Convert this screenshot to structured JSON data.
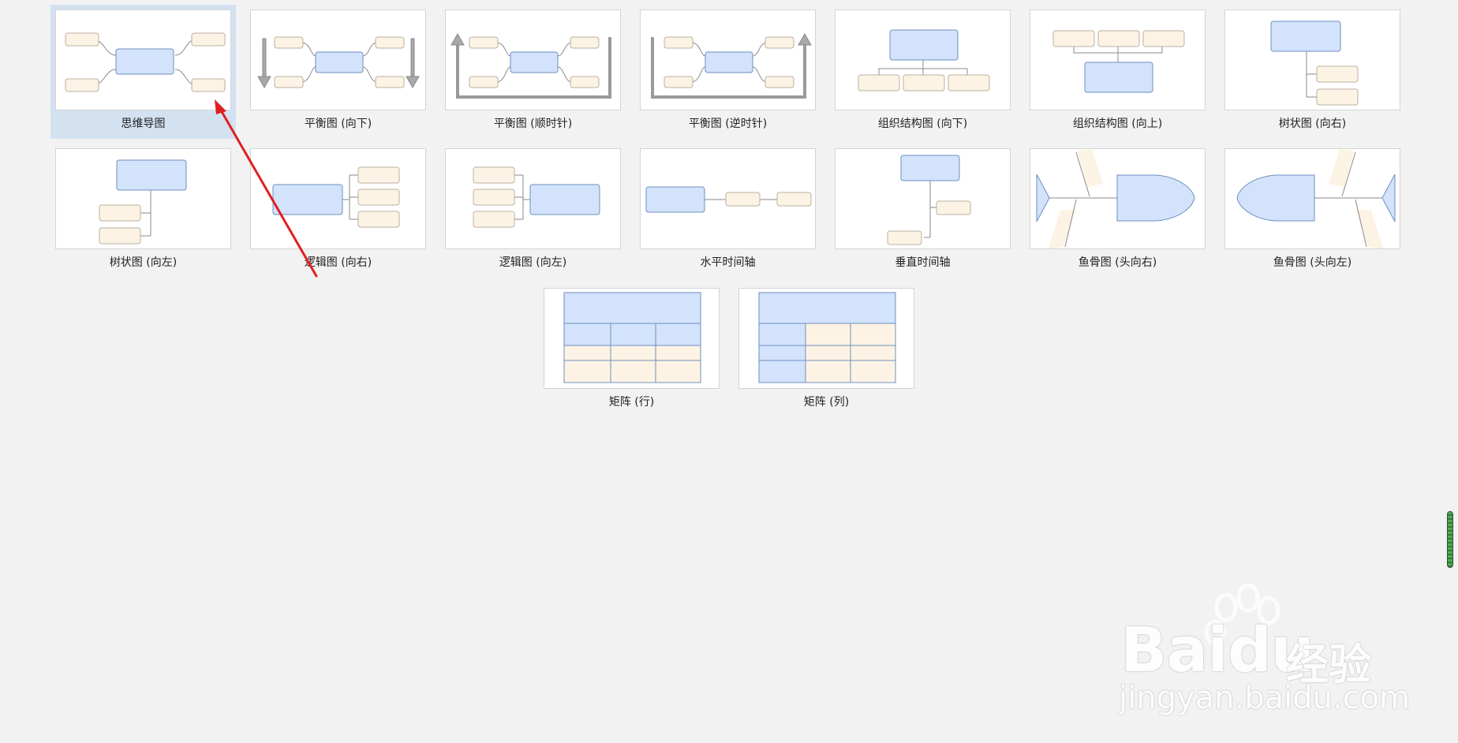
{
  "templates": [
    {
      "id": "mind-map",
      "label": "思维导图",
      "selected": true
    },
    {
      "id": "balance-down",
      "label": "平衡图 (向下)"
    },
    {
      "id": "balance-clockwise",
      "label": "平衡图 (顺时针)"
    },
    {
      "id": "balance-counterclockwise",
      "label": "平衡图 (逆时针)"
    },
    {
      "id": "org-chart-down",
      "label": "组织结构图 (向下)"
    },
    {
      "id": "org-chart-up",
      "label": "组织结构图 (向上)"
    },
    {
      "id": "tree-right",
      "label": "树状图 (向右)"
    },
    {
      "id": "tree-left",
      "label": "树状图 (向左)"
    },
    {
      "id": "logic-right",
      "label": "逻辑图 (向右)"
    },
    {
      "id": "logic-left",
      "label": "逻辑图 (向左)"
    },
    {
      "id": "timeline-horizontal",
      "label": "水平时间轴"
    },
    {
      "id": "timeline-vertical",
      "label": "垂直时间轴"
    },
    {
      "id": "fishbone-right",
      "label": "鱼骨图 (头向右)"
    },
    {
      "id": "fishbone-left",
      "label": "鱼骨图 (头向左)"
    },
    {
      "id": "matrix-row",
      "label": "矩阵 (行)"
    },
    {
      "id": "matrix-column",
      "label": "矩阵 (列)"
    }
  ],
  "watermark": {
    "brand": "Baidu",
    "product": "经验",
    "url": "jingyan.baidu.com"
  },
  "colors": {
    "main_node_fill": "#d3e3fb",
    "main_node_stroke": "#6e8fc0",
    "sub_node_fill": "#fdf3e4",
    "sub_node_stroke": "#b9b0a2",
    "connector": "#8a8a8a",
    "selection_bg": "#d3e1f1",
    "annotation_arrow": "#e02020"
  }
}
